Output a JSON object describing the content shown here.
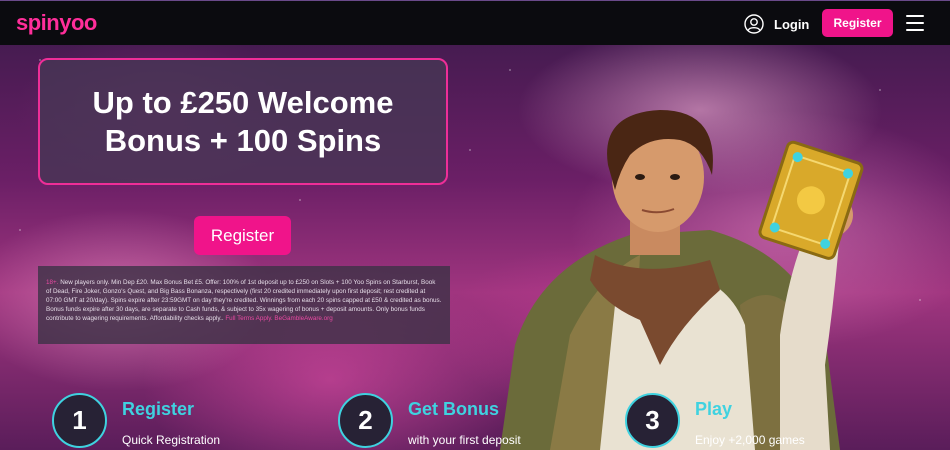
{
  "header": {
    "logo": "spinyoo",
    "login_label": "Login",
    "register_label": "Register",
    "icons": {
      "user": "user-icon",
      "menu": "hamburger-menu-icon"
    }
  },
  "promo": {
    "headline": "Up to £250 Welcome Bonus + 100 Spins",
    "register_label": "Register",
    "terms_prefix": "18+.",
    "terms": "New players only. Min Dep £20. Max Bonus Bet £5. Offer: 100% of 1st deposit up to £250 on Slots + 100 Yoo Spins on Starburst, Book of Dead, Fire Joker, Gonzo's Quest, and Big Bass Bonanza, respectively (first 20 credited immediately upon first deposit; rest credited at 07:00 GMT at 20/day). Spins expire after 23:59GMT on day they're credited. Winnings from each 20 spins capped at £50 & credited as bonus. Bonus funds expire after 30 days, are separate to Cash funds, & subject to 35x wagering of bonus + deposit amounts. Only bonus funds contribute to wagering requirements. Affordability checks apply..",
    "terms_links": "Full Terms Apply. BeGambleAware.org"
  },
  "steps": [
    {
      "number": "1",
      "title": "Register",
      "subtitle": "Quick Registration"
    },
    {
      "number": "2",
      "title": "Get Bonus",
      "subtitle": "with your first deposit"
    },
    {
      "number": "3",
      "title": "Play",
      "subtitle": "Enjoy +2,000 games"
    }
  ],
  "colors": {
    "accent": "#f0148a",
    "teal": "#3fd2e0",
    "header_bg": "#0b0b0f"
  }
}
